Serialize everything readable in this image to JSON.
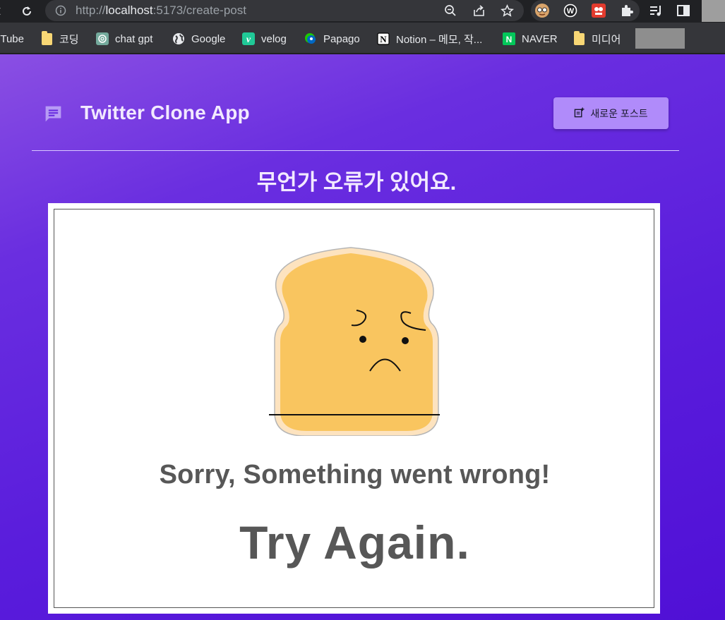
{
  "browser": {
    "url_prefix": "http://",
    "url_host": "localhost",
    "url_path": ":5173/create-post"
  },
  "bookmarks": [
    {
      "label": "nTube",
      "icon": "none"
    },
    {
      "label": "코딩",
      "icon": "folder-icon"
    },
    {
      "label": "chat gpt",
      "icon": "chatgpt-icon"
    },
    {
      "label": "Google",
      "icon": "globe-icon"
    },
    {
      "label": "velog",
      "icon": "velog-icon"
    },
    {
      "label": "Papago",
      "icon": "papago-icon"
    },
    {
      "label": "Notion – 메모, 작...",
      "icon": "notion-icon"
    },
    {
      "label": "NAVER",
      "icon": "naver-icon"
    },
    {
      "label": "미디어",
      "icon": "folder-icon"
    }
  ],
  "app": {
    "title": "Twitter Clone App",
    "new_post_label": "새로운 포스트",
    "error_heading": "무언가 오류가 있어요.",
    "error_image": {
      "line1": "Sorry, Something went wrong!",
      "line2": "Try Again."
    }
  },
  "colors": {
    "gradient_start": "#8a4fe3",
    "gradient_end": "#5010d6",
    "button_bg": "#b08bfa",
    "toast_fill": "#f9c55f"
  }
}
